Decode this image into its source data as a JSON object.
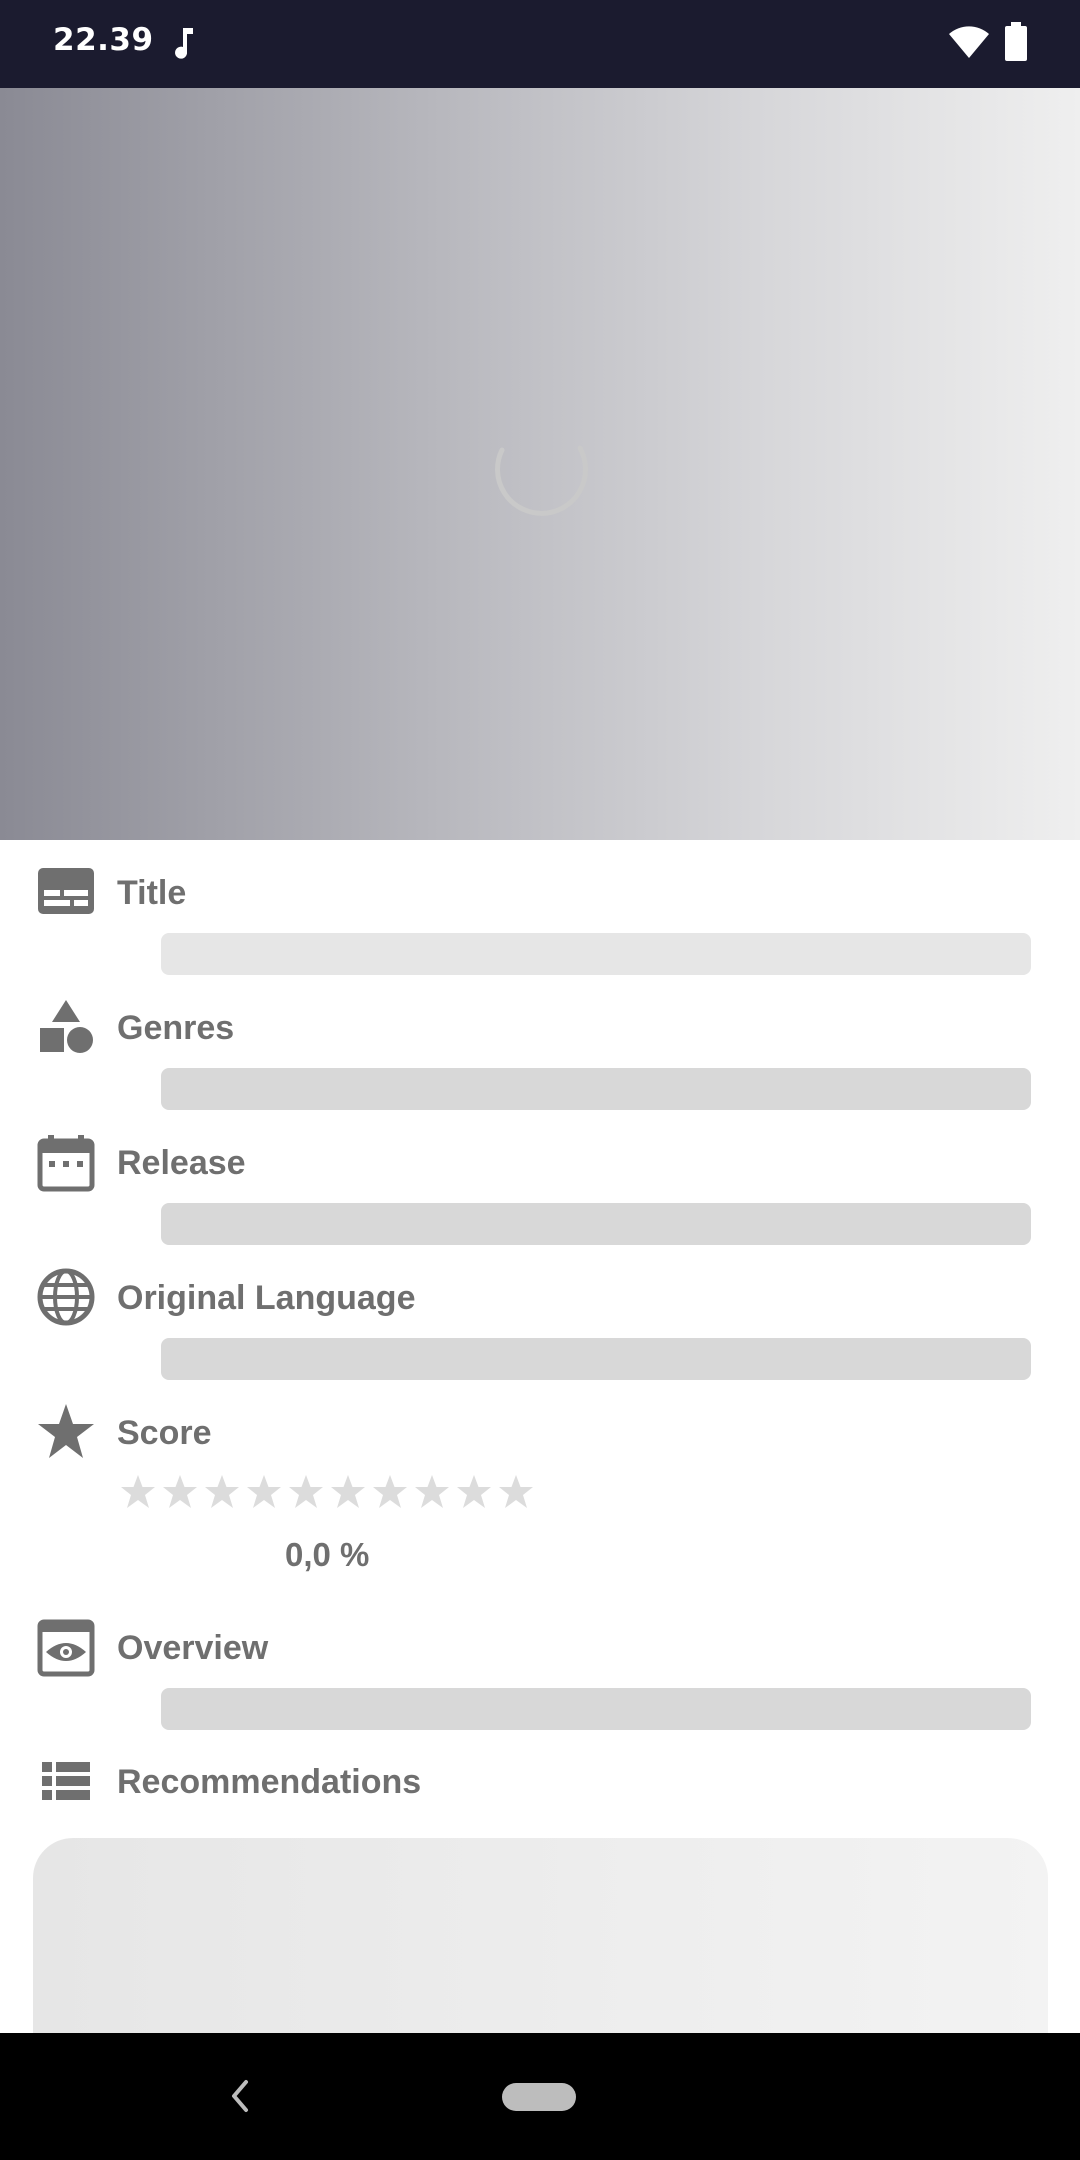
{
  "status_bar": {
    "time": "22.39",
    "icons": [
      "music-note-icon",
      "wifi-icon",
      "battery-icon"
    ]
  },
  "hero": {
    "loading": true
  },
  "details": {
    "title_label": "Title",
    "genres_label": "Genres",
    "release_label": "Release",
    "original_language_label": "Original Language",
    "score_label": "Score",
    "score_value": "0,0 %",
    "score_stars_filled": 0,
    "score_stars_total": 10,
    "overview_label": "Overview",
    "recommendations_label": "Recommendations"
  },
  "icons": {
    "title": "subtitles-icon",
    "genres": "shapes-icon",
    "release": "calendar-icon",
    "original_language": "globe-icon",
    "score": "star-icon",
    "overview": "eye-icon",
    "recommendations": "list-icon"
  },
  "colors": {
    "status_bar": "#1b1b2f",
    "label_text": "#6f6f6f",
    "placeholder": "#d8d8d8",
    "star_empty": "#dcdcdc"
  },
  "nav_bar": {
    "buttons": [
      "back-icon",
      "home-pill"
    ]
  }
}
